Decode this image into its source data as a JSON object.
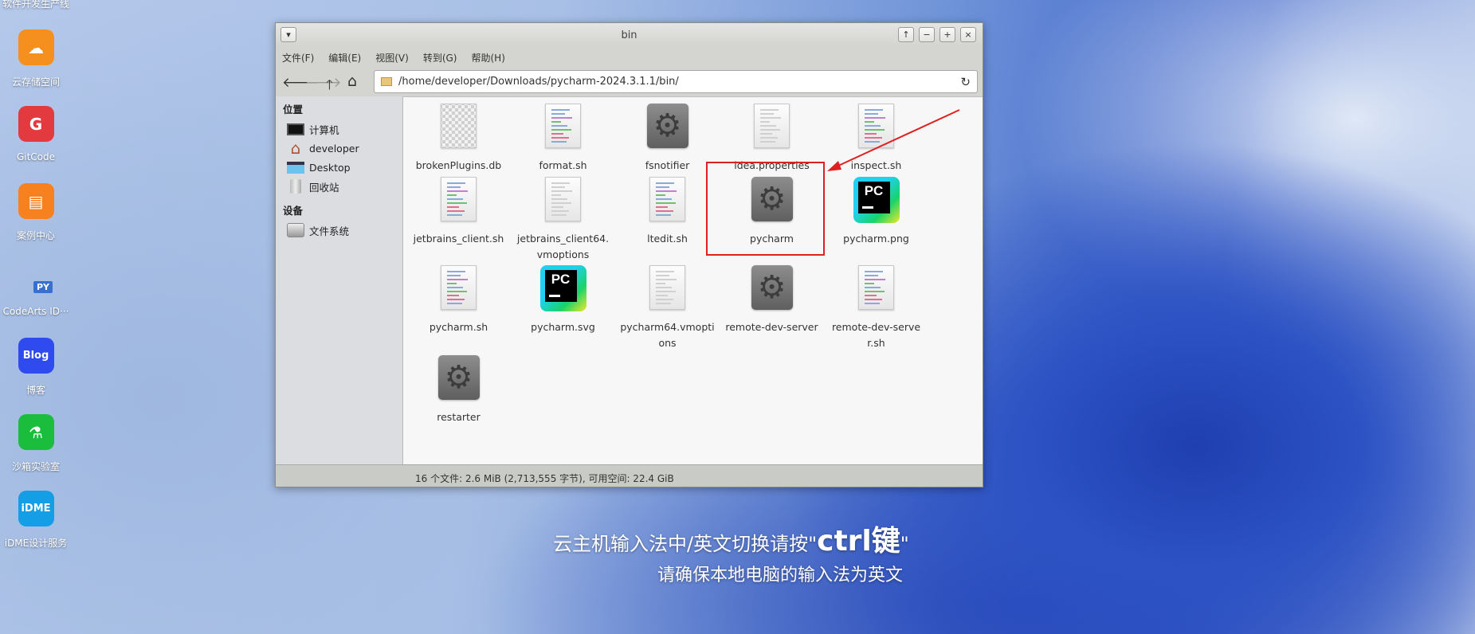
{
  "desktop": {
    "top_label": "软件开发生产线",
    "icons": [
      {
        "label": "云存储空间",
        "color": "#f5901e",
        "glyph": "☁"
      },
      {
        "label": "GitCode",
        "color": "#e33a3f",
        "glyph": "G"
      },
      {
        "label": "案例中心",
        "color": "#f7801f",
        "glyph": "▤"
      },
      {
        "label": "CodeArts ID···",
        "color": "transparent",
        "glyph": "PY"
      },
      {
        "label": "博客",
        "color": "#2f4bf0",
        "glyph": "Blog"
      },
      {
        "label": "沙箱实验室",
        "color": "#1bbd3c",
        "glyph": "⚗"
      },
      {
        "label": "iDME设计服务",
        "color": "#139ee6",
        "glyph": "iDME"
      }
    ]
  },
  "window": {
    "title": "bin",
    "buttons": {
      "menu": "▾",
      "raise": "↑",
      "minimize": "−",
      "maximize": "+",
      "close": "×"
    }
  },
  "menu": [
    "文件(F)",
    "编辑(E)",
    "视图(V)",
    "转到(G)",
    "帮助(H)"
  ],
  "toolbar": {
    "back": "🡐",
    "forward": "🡒",
    "up": "🡑",
    "home": "⌂",
    "path": "/home/developer/Downloads/pycharm-2024.3.1.1/bin/",
    "reload": "↻"
  },
  "sidebar": {
    "places_header": "位置",
    "places": [
      {
        "label": "计算机",
        "icon": "computer-icon"
      },
      {
        "label": "developer",
        "icon": "home-icon"
      },
      {
        "label": "Desktop",
        "icon": "desktop-icon"
      },
      {
        "label": "回收站",
        "icon": "trash-icon"
      }
    ],
    "devices_header": "设备",
    "devices": [
      {
        "label": "文件系统",
        "icon": "drive-icon"
      }
    ]
  },
  "files": [
    {
      "name": "brokenPlugins.db",
      "type": "binary"
    },
    {
      "name": "format.sh",
      "type": "script"
    },
    {
      "name": "fsnotifier",
      "type": "executable"
    },
    {
      "name": "idea.properties",
      "type": "text"
    },
    {
      "name": "inspect.sh",
      "type": "script"
    },
    {
      "name": "jetbrains_client.sh",
      "type": "script"
    },
    {
      "name": "jetbrains_client64.vmoptions",
      "type": "text"
    },
    {
      "name": "ltedit.sh",
      "type": "script"
    },
    {
      "name": "pycharm",
      "type": "executable",
      "highlighted": true
    },
    {
      "name": "pycharm.png",
      "type": "pycharm-logo"
    },
    {
      "name": "pycharm.sh",
      "type": "script"
    },
    {
      "name": "pycharm.svg",
      "type": "pycharm-logo"
    },
    {
      "name": "pycharm64.vmoptions",
      "type": "text"
    },
    {
      "name": "remote-dev-server",
      "type": "executable"
    },
    {
      "name": "remote-dev-server.sh",
      "type": "script"
    },
    {
      "name": "restarter",
      "type": "executable"
    }
  ],
  "status": "16 个文件: 2.6 MiB (2,713,555 字节), 可用空间: 22.4 GiB",
  "hint": {
    "line1_prefix": "云主机输入法中/英文切换请按\"",
    "line1_key": "ctrl键",
    "line1_suffix": "\"",
    "line2": "请确保本地电脑的输入法为英文"
  },
  "annotation_color": "#e02020"
}
